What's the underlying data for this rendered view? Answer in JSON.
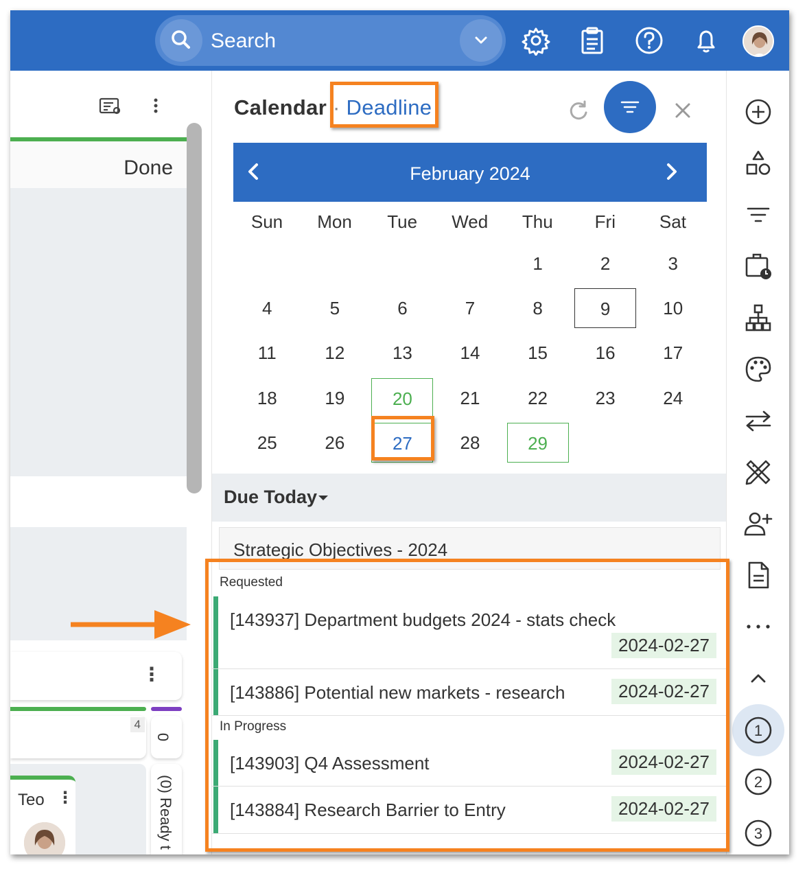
{
  "topbar": {
    "search_placeholder": "Search",
    "icons": [
      "search-icon",
      "chevron-down-icon",
      "gear-icon",
      "clipboard-icon",
      "help-icon",
      "bell-icon",
      "avatar"
    ]
  },
  "board": {
    "column_done_label": "Done",
    "card_count": "4",
    "collapsed_count": "0",
    "collapsed_label": "(0) Ready t",
    "user_name": "Teo"
  },
  "calendar": {
    "title": "Calendar",
    "separator": "·",
    "mode": "Deadline",
    "month_label": "February 2024",
    "weekdays": [
      "Sun",
      "Mon",
      "Tue",
      "Wed",
      "Thu",
      "Fri",
      "Sat"
    ],
    "days": [
      "1",
      "2",
      "3",
      "4",
      "5",
      "6",
      "7",
      "8",
      "9",
      "10",
      "11",
      "12",
      "13",
      "14",
      "15",
      "16",
      "17",
      "18",
      "19",
      "20",
      "21",
      "22",
      "23",
      "24",
      "25",
      "26",
      "27",
      "28",
      "29"
    ],
    "first_weekday_index": 4,
    "today": "9",
    "selected": "27",
    "has_deadline": [
      "20",
      "29"
    ],
    "colors": {
      "accent": "#2d6cc2",
      "deadline": "#4caf50",
      "highlight": "#f58220"
    }
  },
  "due": {
    "label": "Due Today",
    "group_title": "Strategic Objectives - 2024",
    "statuses": [
      {
        "label": "Requested",
        "tasks": [
          {
            "name": "[143937] Department budgets 2024 - stats check",
            "date": "2024-02-27"
          },
          {
            "name": "[143886] Potential new markets - research",
            "date": "2024-02-27"
          }
        ]
      },
      {
        "label": "In Progress",
        "tasks": [
          {
            "name": "[143903] Q4 Assessment",
            "date": "2024-02-27"
          },
          {
            "name": "[143884] Research Barrier to Entry",
            "date": "2024-02-27"
          }
        ]
      }
    ]
  },
  "sidebar": {
    "icons": [
      "plus-circle-icon",
      "shapes-icon",
      "filter-lines-icon",
      "briefcase-clock-icon",
      "hierarchy-icon",
      "palette-icon",
      "swap-arrows-icon",
      "tools-icon",
      "add-user-icon",
      "document-icon",
      "more-icon",
      "chevron-up-icon"
    ],
    "numbers": [
      "1",
      "2",
      "3"
    ]
  }
}
